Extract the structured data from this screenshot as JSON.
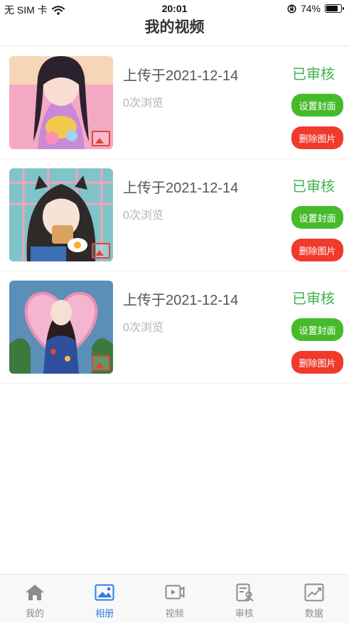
{
  "status_bar": {
    "carrier": "无 SIM 卡",
    "time": "20:01",
    "battery": "74%",
    "battery_level": 0.74
  },
  "nav": {
    "title": "我的视频"
  },
  "items": [
    {
      "upload_date": "上传于2021-12-14",
      "views": "0次浏览",
      "status": "已审核",
      "cover_button": "设置封面",
      "delete_button": "删除图片"
    },
    {
      "upload_date": "上传于2021-12-14",
      "views": "0次浏览",
      "status": "已审核",
      "cover_button": "设置封面",
      "delete_button": "删除图片"
    },
    {
      "upload_date": "上传于2021-12-14",
      "views": "0次浏览",
      "status": "已审核",
      "cover_button": "设置封面",
      "delete_button": "删除图片"
    }
  ],
  "tabs": [
    {
      "label": "我的",
      "icon": "home-icon",
      "active": false
    },
    {
      "label": "相册",
      "icon": "image-icon",
      "active": true
    },
    {
      "label": "视频",
      "icon": "video-icon",
      "active": false
    },
    {
      "label": "审核",
      "icon": "review-icon",
      "active": false
    },
    {
      "label": "数据",
      "icon": "chart-icon",
      "active": false
    }
  ],
  "colors": {
    "status": "#3bb54a",
    "cover_button": "#45bb2b",
    "delete_button": "#f03a2b",
    "active_tab": "#2f7de1",
    "inactive_tab": "#8c8c8c"
  }
}
